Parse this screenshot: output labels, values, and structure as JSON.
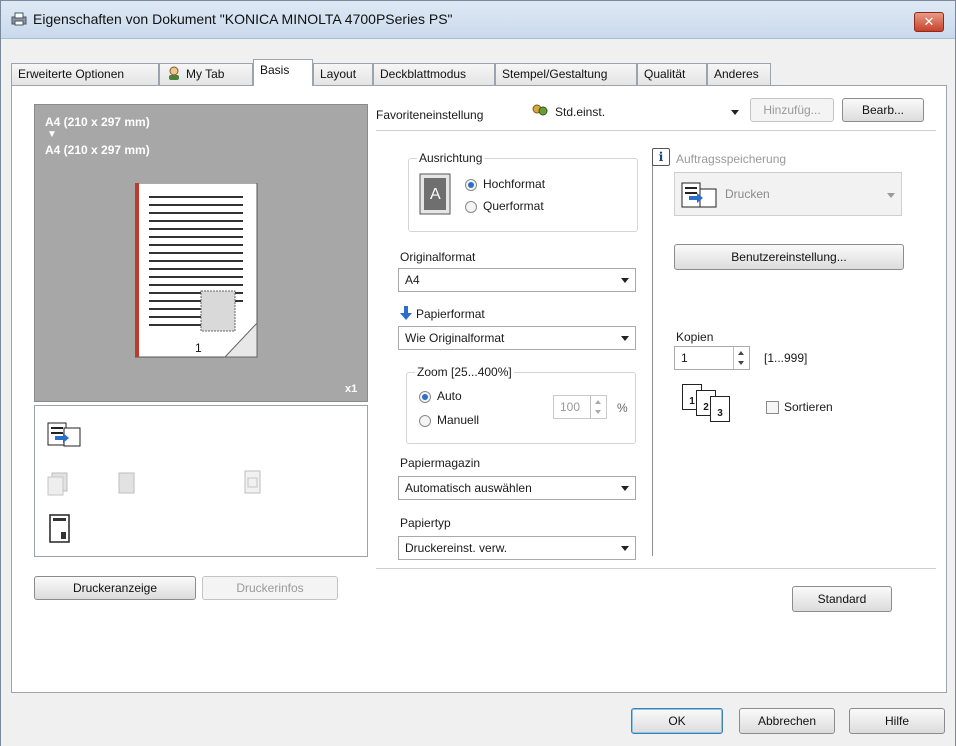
{
  "window": {
    "title": "Eigenschaften von Dokument \"KONICA MINOLTA 4700PSeries PS\"",
    "close_glyph": "✕"
  },
  "tabs": [
    {
      "label": "Erweiterte Optionen"
    },
    {
      "label": "My Tab"
    },
    {
      "label": "Basis"
    },
    {
      "label": "Layout"
    },
    {
      "label": "Deckblattmodus"
    },
    {
      "label": "Stempel/Gestaltung"
    },
    {
      "label": "Qualität"
    },
    {
      "label": "Anderes"
    }
  ],
  "preview": {
    "source_size": "A4 (210 x 297 mm)",
    "arrow": "▼",
    "target_size": "A4 (210 x 297 mm)",
    "page_number": "1",
    "copies_badge": "x1"
  },
  "left_buttons": {
    "printer_display": "Druckeranzeige",
    "printer_info": "Druckerinfos"
  },
  "favorites": {
    "label": "Favoriteneinstellung",
    "value": "Std.einst.",
    "add_button": "Hinzufüg...",
    "edit_button": "Bearb..."
  },
  "orientation": {
    "label": "Ausrichtung",
    "icon_letter": "A",
    "portrait": "Hochformat",
    "landscape": "Querformat"
  },
  "original_format": {
    "label": "Originalformat",
    "value": "A4"
  },
  "paper_format": {
    "label": "Papierformat",
    "value": "Wie Originalformat"
  },
  "zoom": {
    "label": "Zoom [25...400%]",
    "auto": "Auto",
    "manual": "Manuell",
    "value": "100",
    "unit": "%"
  },
  "paper_tray": {
    "label": "Papiermagazin",
    "value": "Automatisch auswählen"
  },
  "paper_type": {
    "label": "Papiertyp",
    "value": "Druckereinst. verw."
  },
  "job_storage": {
    "info_glyph": "i",
    "label": "Auftragsspeicherung",
    "value": "Drucken",
    "user_settings_button": "Benutzereinstellung..."
  },
  "copies": {
    "label": "Kopien",
    "value": "1",
    "range": "[1...999]",
    "sort_label": "Sortieren",
    "sort_icon_digits": [
      "1",
      "2",
      "3"
    ]
  },
  "standard_button": "Standard",
  "dialog_buttons": {
    "ok": "OK",
    "cancel": "Abbrechen",
    "help": "Hilfe"
  },
  "colors": {
    "accent": "#2a6fc9",
    "preview_bg": "#a7a7a7",
    "close": "#c7422b"
  }
}
